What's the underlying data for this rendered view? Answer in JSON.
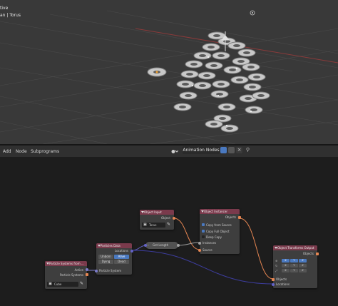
{
  "viewport": {
    "mode_text": "tive",
    "object_text": "an | Torus"
  },
  "header": {
    "menus": [
      "Add",
      "Node",
      "Subprograms"
    ],
    "tree_name": "Animation Nodes",
    "colors": {
      "accent": "#4a79c0",
      "node_header": "#7a3a4c"
    }
  },
  "nodes": {
    "particle_systems_from": {
      "title": "Particle Systems from ...",
      "active_label": "Active",
      "output_label": "Particle Systems",
      "object_value": "Cube"
    },
    "particles_data": {
      "title": "Particles Data",
      "output_label": "Locations",
      "buttons": [
        "Unborn",
        "Alive",
        "Dying",
        "Dead"
      ],
      "input_label": "Particle System"
    },
    "object_input": {
      "title": "Object Input",
      "output_label": "Object",
      "object_value": "Torus"
    },
    "get_length": {
      "title": "Get Length"
    },
    "object_instancer": {
      "title": "Object Instancer",
      "output_label": "Objects",
      "options": [
        "Copy from Source",
        "Copy Full Object",
        "Deep Copy"
      ],
      "inputs": [
        "Instances",
        "Source"
      ]
    },
    "object_transforms_output": {
      "title": "Object Transforms Output",
      "output_label": "Objects",
      "axes": [
        "X",
        "Y",
        "Z"
      ],
      "inputs": [
        "Objects",
        "Locations"
      ]
    }
  }
}
